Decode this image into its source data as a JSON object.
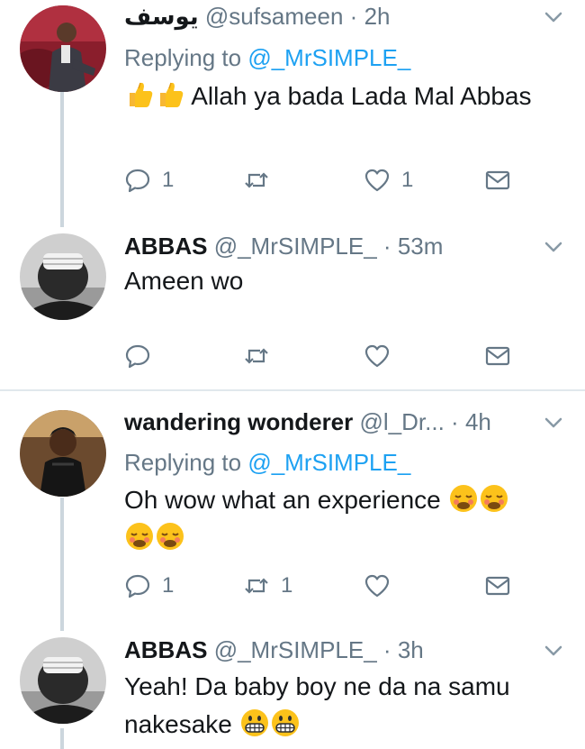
{
  "tweets": [
    {
      "name": "يوسف",
      "handle": "@sufsameen",
      "sep": "·",
      "time": "2h",
      "replying_label": "Replying to",
      "replying_to": "@_MrSIMPLE_",
      "text": "Allah ya bada Lada Mal Abbas",
      "emoji": [
        "thumbs-up",
        "thumbs-up"
      ],
      "reply_count": "1",
      "retweet_count": "",
      "like_count": "1"
    },
    {
      "name": "ABBAS",
      "handle": "@_MrSIMPLE_",
      "sep": "·",
      "time": "53m",
      "text": "Ameen wo",
      "reply_count": "",
      "retweet_count": "",
      "like_count": ""
    },
    {
      "name": "wandering wonderer",
      "handle": "@l_Dr...",
      "sep": "·",
      "time": "4h",
      "replying_label": "Replying to",
      "replying_to": "@_MrSIMPLE_",
      "text": "Oh wow what an experience",
      "emoji": [
        "sleepy-face",
        "sleepy-face",
        "sleepy-face",
        "sleepy-face"
      ],
      "reply_count": "1",
      "retweet_count": "1",
      "like_count": ""
    },
    {
      "name": "ABBAS",
      "handle": "@_MrSIMPLE_",
      "sep": "·",
      "time": "3h",
      "text": "Yeah! Da baby boy ne da na samu nakesake",
      "emoji": [
        "grinning-face",
        "grinning-face"
      ]
    }
  ],
  "colors": {
    "text": "#14171a",
    "secondary": "#657786",
    "link": "#1da1f2",
    "thread_line": "#ccd6dd",
    "divider": "#e1e8ed"
  }
}
